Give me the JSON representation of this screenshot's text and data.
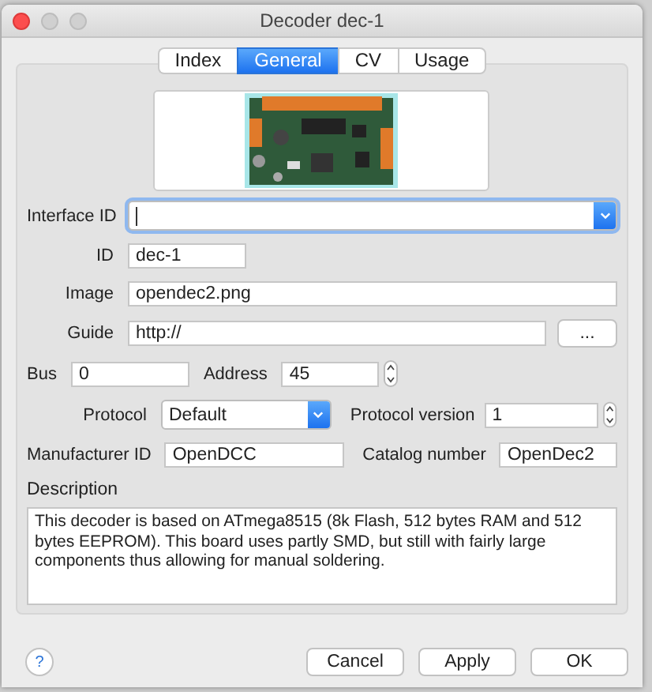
{
  "window": {
    "title": "Decoder dec-1"
  },
  "tabs": [
    {
      "label": "Index",
      "selected": false
    },
    {
      "label": "General",
      "selected": true
    },
    {
      "label": "CV",
      "selected": false
    },
    {
      "label": "Usage",
      "selected": false
    }
  ],
  "interface_id": {
    "label": "Interface ID",
    "focused": true
  },
  "id": {
    "label": "ID",
    "value": "dec-1"
  },
  "image": {
    "label": "Image",
    "value": "opendec2.png"
  },
  "guide": {
    "label": "Guide",
    "value": "http://",
    "button": "..."
  },
  "bus": {
    "label": "Bus",
    "value": "0"
  },
  "address": {
    "label": "Address",
    "value": "45"
  },
  "protocol": {
    "label": "Protocol",
    "value": "Default"
  },
  "protocol_version": {
    "label": "Protocol version",
    "value": "1"
  },
  "manufacturer_id": {
    "label": "Manufacturer ID",
    "value": "OpenDCC"
  },
  "catalog_number": {
    "label": "Catalog number",
    "value": "OpenDec2"
  },
  "description": {
    "label": "Description",
    "value": "This decoder is based on ATmega8515 (8k Flash, 512 bytes RAM and 512 bytes EEPROM). This board uses partly SMD, but still with fairly large components thus allowing for manual soldering."
  },
  "help": "?",
  "buttons": [
    "Cancel",
    "Apply",
    "OK"
  ]
}
